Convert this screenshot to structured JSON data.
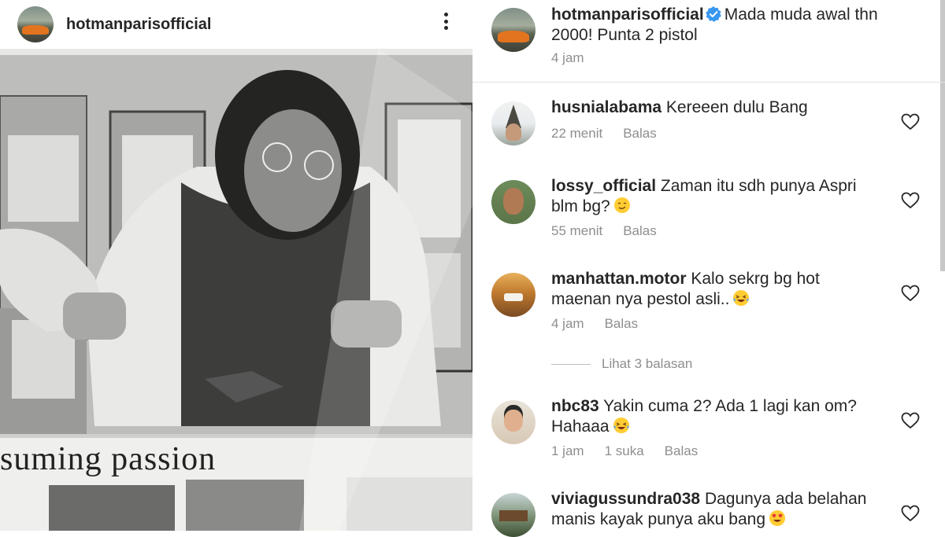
{
  "post": {
    "author": "hotmanparisofficial",
    "caption": "Mada muda awal thn 2000! Punta 2 pistol",
    "time": "4 jam",
    "photo_text": "suming passion"
  },
  "comments": [
    {
      "username": "husnialabama",
      "text": "Kereeen dulu Bang",
      "emoji": "",
      "time": "22 menit",
      "likes": "",
      "reply": "Balas"
    },
    {
      "username": "lossy_official",
      "text": "Zaman itu sdh punya Aspri blm bg?",
      "emoji": "smirk-emoji",
      "time": "55 menit",
      "likes": "",
      "reply": "Balas"
    },
    {
      "username": "manhattan.motor",
      "text": "Kalo sekrg bg hot maenan nya pestol asli..",
      "emoji": "laughing-tears-emoji",
      "time": "4 jam",
      "likes": "",
      "reply": "Balas"
    },
    {
      "username": "nbc83",
      "text": "Yakin cuma 2? Ada 1 lagi kan om? Hahaaa",
      "emoji": "laughing-tears-emoji",
      "time": "1 jam",
      "likes": "1 suka",
      "reply": "Balas"
    },
    {
      "username": "viviagussundra038",
      "text": "Dagunya ada belahan manis kayak punya aku bang",
      "emoji": "heart-eyes-emoji",
      "time": "",
      "likes": "",
      "reply": ""
    }
  ],
  "view_replies": "Lihat 3 balasan",
  "colors": {
    "text": "#262626",
    "secondary": "#8e8e8e",
    "verified": "#3897f0",
    "divider": "#e3e3e3"
  },
  "icons": {
    "more": "more-options-icon",
    "verified": "verified-badge-icon",
    "like": "heart-outline-icon"
  }
}
